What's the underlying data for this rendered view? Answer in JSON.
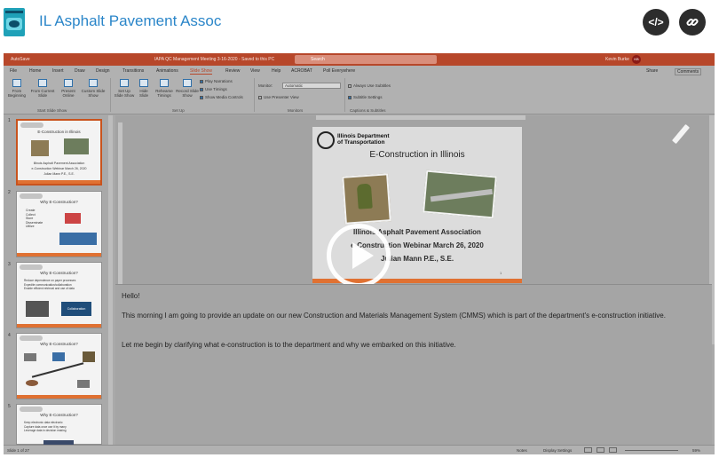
{
  "header": {
    "site_title": "IL Asphalt Pavement Assoc",
    "embed_icon": "code-icon",
    "link_icon": "link-icon"
  },
  "video": {
    "powerpoint": {
      "titlebar": {
        "autosave": "AutoSave",
        "document_name": "IAPA QC Management Meeting 3-16-2020 - Saved to this PC",
        "search_placeholder": "Search",
        "user_name": "Kevin Burke",
        "user_initials": "KB"
      },
      "tabs": [
        "File",
        "Home",
        "Insert",
        "Draw",
        "Design",
        "Transitions",
        "Animations",
        "Slide Show",
        "Review",
        "View",
        "Help",
        "ACROBAT",
        "Poll Everywhere"
      ],
      "active_tab": "Slide Show",
      "share_label": "Share",
      "comments_label": "Comments",
      "ribbon": {
        "start": {
          "buttons": [
            "From Beginning",
            "From Current Slide",
            "Present Online",
            "Custom Slide Show"
          ],
          "label": "Start Slide Show"
        },
        "setup": {
          "buttons": [
            "Set Up Slide Show",
            "Hide Slide",
            "Rehearse Timings",
            "Record Slide Show"
          ],
          "checkboxes": [
            "Play Narrations",
            "Use Timings",
            "Show Media Controls"
          ],
          "label": "Set Up"
        },
        "monitors": {
          "monitor_label": "Monitor:",
          "monitor_value": "Automatic",
          "presenter_view": "Use Presenter View",
          "label": "Monitors"
        },
        "captions": {
          "always_subtitles": "Always Use Subtitles",
          "subtitle_settings": "Subtitle Settings",
          "label": "Captions & Subtitles"
        }
      },
      "thumbnails": [
        {
          "num": "1",
          "title": "E-Construction in Illinois",
          "line1": "Illinois Asphalt Pavement Association",
          "line2": "e-Construction Webinar March 26, 2020",
          "line3": "Julian Mann P.E., S.E."
        },
        {
          "num": "2",
          "title": "Why E-Construction?",
          "bullets": [
            "Create",
            "Collect",
            "Store",
            "Disseminate",
            "Utilize"
          ]
        },
        {
          "num": "3",
          "title": "Why E-Construction?",
          "bullets": [
            "Reduce dependence on paper processes",
            "Expedite communication/collaboration",
            "Enable efficient retrieval and use of data"
          ],
          "badge": "Collaboration"
        },
        {
          "num": "4",
          "title": "Why E-Construction?"
        },
        {
          "num": "5",
          "title": "Why E-Construction?",
          "bullets": [
            "Keep electronic data electronic",
            "Capture data once use it by many",
            "Leverage data in decision making"
          ]
        }
      ],
      "slide": {
        "logo_text_1": "Illinois Department",
        "logo_text_2": "of Transportation",
        "title": "E-Construction in Illinois",
        "line1": "Illinois Asphalt Pavement Association",
        "line2": "e-Construction Webinar March 26, 2020",
        "line3": "Julian Mann P.E., S.E.",
        "page_num": "1"
      },
      "notes": {
        "p1": "Hello!",
        "p2": "This morning I am going to provide an update on our new Construction and Materials Management System (CMMS) which is part of the department's e-construction initiative.",
        "p3": "Let me begin by clarifying what e-construction is to the department and why we embarked on this initiative."
      },
      "status": {
        "slide_count": "Slide 1 of 27",
        "notes_label": "Notes",
        "display_settings": "Display Settings",
        "zoom": "59%"
      }
    },
    "play_icon": "play-icon",
    "pen_icon": "pencil-icon"
  }
}
